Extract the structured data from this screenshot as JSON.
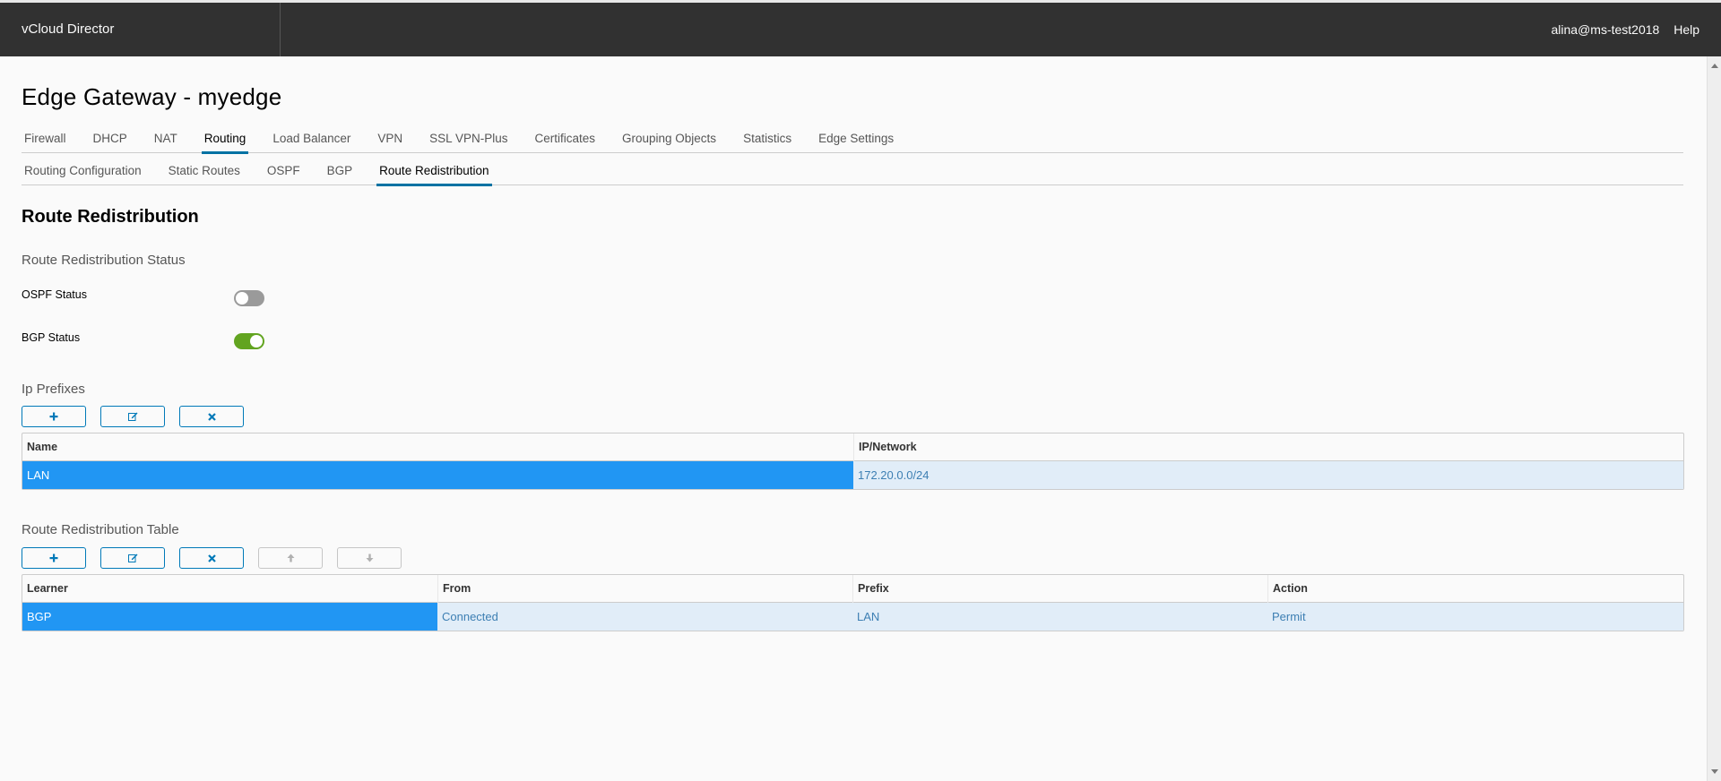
{
  "header": {
    "brand": "vCloud Director",
    "user": "alina@ms-test2018",
    "help": "Help"
  },
  "page": {
    "title": "Edge Gateway - myedge"
  },
  "main_tabs": [
    {
      "label": "Firewall",
      "active": false
    },
    {
      "label": "DHCP",
      "active": false
    },
    {
      "label": "NAT",
      "active": false
    },
    {
      "label": "Routing",
      "active": true
    },
    {
      "label": "Load Balancer",
      "active": false
    },
    {
      "label": "VPN",
      "active": false
    },
    {
      "label": "SSL VPN-Plus",
      "active": false
    },
    {
      "label": "Certificates",
      "active": false
    },
    {
      "label": "Grouping Objects",
      "active": false
    },
    {
      "label": "Statistics",
      "active": false
    },
    {
      "label": "Edge Settings",
      "active": false
    }
  ],
  "sub_tabs": [
    {
      "label": "Routing Configuration",
      "active": false
    },
    {
      "label": "Static Routes",
      "active": false
    },
    {
      "label": "OSPF",
      "active": false
    },
    {
      "label": "BGP",
      "active": false
    },
    {
      "label": "Route Redistribution",
      "active": true
    }
  ],
  "section": {
    "title": "Route Redistribution",
    "status_title": "Route Redistribution Status",
    "toggles": [
      {
        "label": "OSPF Status",
        "on": false
      },
      {
        "label": "BGP Status",
        "on": true
      }
    ]
  },
  "ip_prefixes": {
    "title": "Ip Prefixes",
    "buttons": [
      {
        "icon": "plus-icon",
        "enabled": true
      },
      {
        "icon": "edit-icon",
        "enabled": true
      },
      {
        "icon": "close-icon",
        "enabled": true
      }
    ],
    "columns": [
      "Name",
      "IP/Network"
    ],
    "rows": [
      {
        "name": "LAN",
        "network": "172.20.0.0/24",
        "selected": true
      }
    ]
  },
  "redistribution_table": {
    "title": "Route Redistribution Table",
    "buttons": [
      {
        "icon": "plus-icon",
        "enabled": true
      },
      {
        "icon": "edit-icon",
        "enabled": true
      },
      {
        "icon": "close-icon",
        "enabled": true
      },
      {
        "icon": "arrow-up-icon",
        "enabled": false
      },
      {
        "icon": "arrow-down-icon",
        "enabled": false
      }
    ],
    "columns": [
      "Learner",
      "From",
      "Prefix",
      "Action"
    ],
    "rows": [
      {
        "learner": "BGP",
        "from": "Connected",
        "prefix": "LAN",
        "action": "Permit",
        "selected": true
      }
    ]
  },
  "colors": {
    "header_bg": "#313131",
    "accent": "#0072a3",
    "selection": "#2196f3",
    "toggle_on": "#62a420",
    "toggle_off": "#9a9a9a"
  }
}
